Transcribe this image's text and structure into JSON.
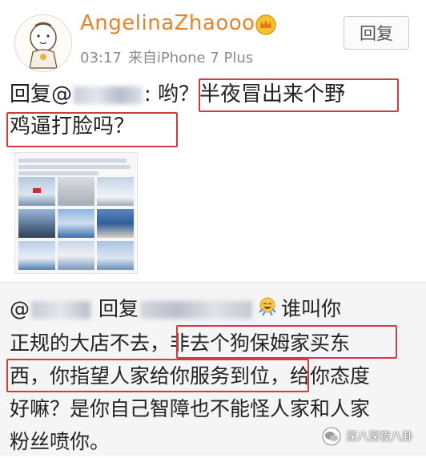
{
  "post": {
    "username": "AngelinaZhaoooo",
    "time": "03:17",
    "source": "来自iPhone 7 Plus",
    "reply_button": "回复",
    "reply_prefix": "回复@",
    "reply_colon": ": 哟？半夜冒出来个野",
    "reply_line2": "鸡逼打脸吗？"
  },
  "comment": {
    "at": "@",
    "reply_word": "回复",
    "line1_tail": "谁叫你",
    "line2": "正规的大店不去，非去个狗保姆家买东",
    "line3": "西，你指望人家给你服务到位，给你态度",
    "line4": "好嘛？是你自己智障也不能怪人家和人家",
    "line5": "粉丝喷你。"
  },
  "watermark": {
    "text": "深八深夜八卦"
  },
  "colors": {
    "username": "#e8822c",
    "highlight_box": "#d23b3b",
    "comment_bg": "#f5f5f5"
  },
  "icons": [
    "avatar-cartoon",
    "crown-icon",
    "emoji-laughing",
    "wechat-logo-icon"
  ]
}
